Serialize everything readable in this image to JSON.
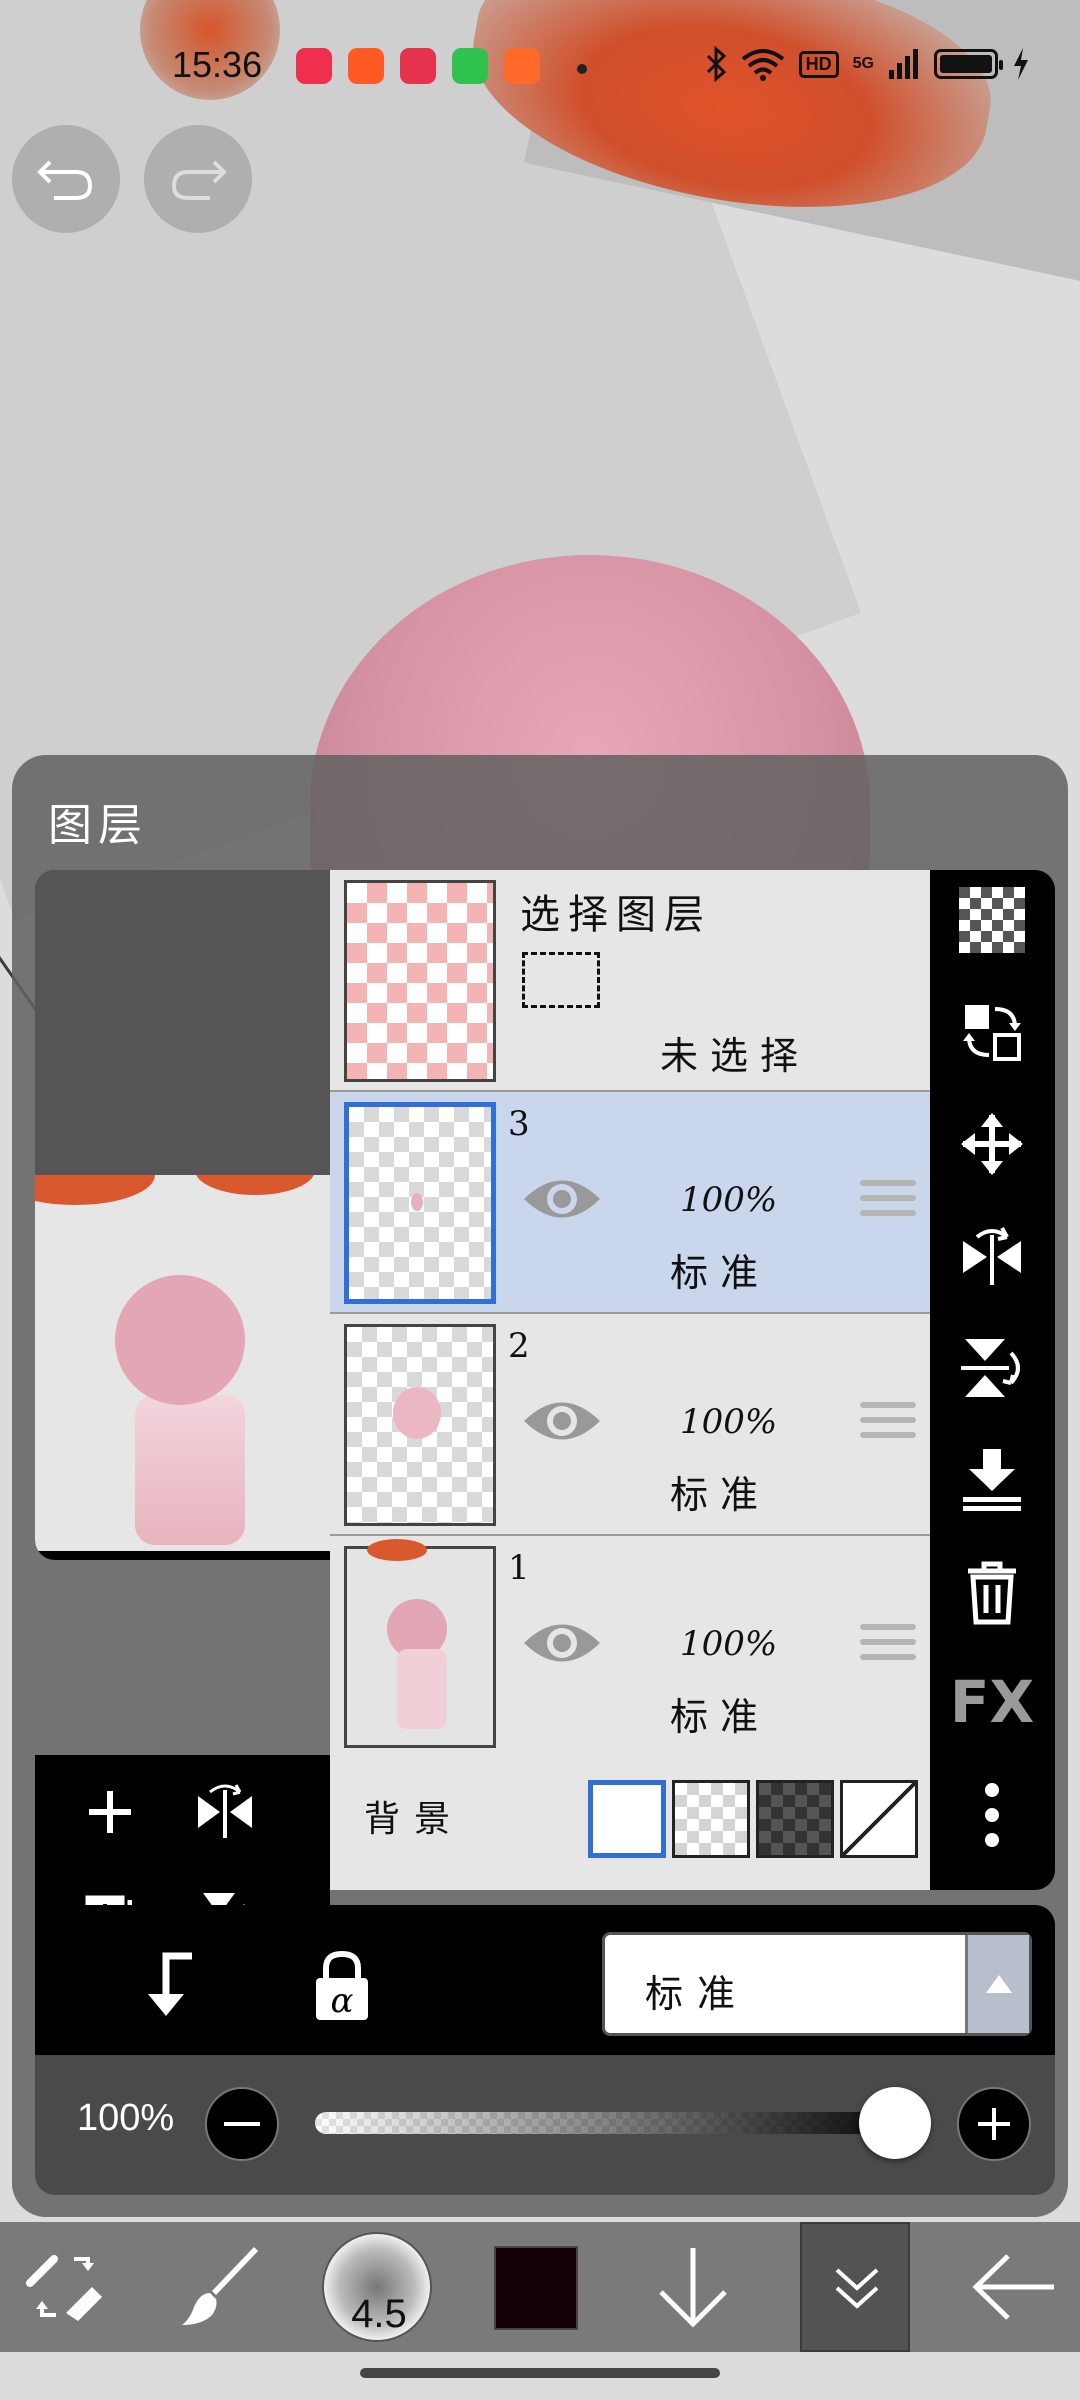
{
  "status_bar": {
    "time": "15:36",
    "network": "5G",
    "hd_label": "HD",
    "notification_colors": [
      "#ef2f4d",
      "#ff5a23",
      "#e5334f",
      "#2fc24f",
      "#ff6a2a"
    ]
  },
  "panel": {
    "title": "图层"
  },
  "selection_layer": {
    "title": "选择图层",
    "status": "未选择"
  },
  "layers": [
    {
      "number": "3",
      "opacity": "100%",
      "blend_mode": "标准",
      "selected": true
    },
    {
      "number": "2",
      "opacity": "100%",
      "blend_mode": "标准",
      "selected": false
    },
    {
      "number": "1",
      "opacity": "100%",
      "blend_mode": "标准",
      "selected": false
    }
  ],
  "background": {
    "label": "背景"
  },
  "right_toolbar": {
    "fx_label": "FX"
  },
  "blend_bar": {
    "blend_mode": "标准"
  },
  "opacity_bar": {
    "value": "100%",
    "level": 1.0
  },
  "bottom_toolbar": {
    "brush_size": "4.5",
    "primary_color": "#15000a"
  },
  "colors": {
    "accent": "#2f6fd6",
    "selected_row": "#c9d6ec"
  }
}
